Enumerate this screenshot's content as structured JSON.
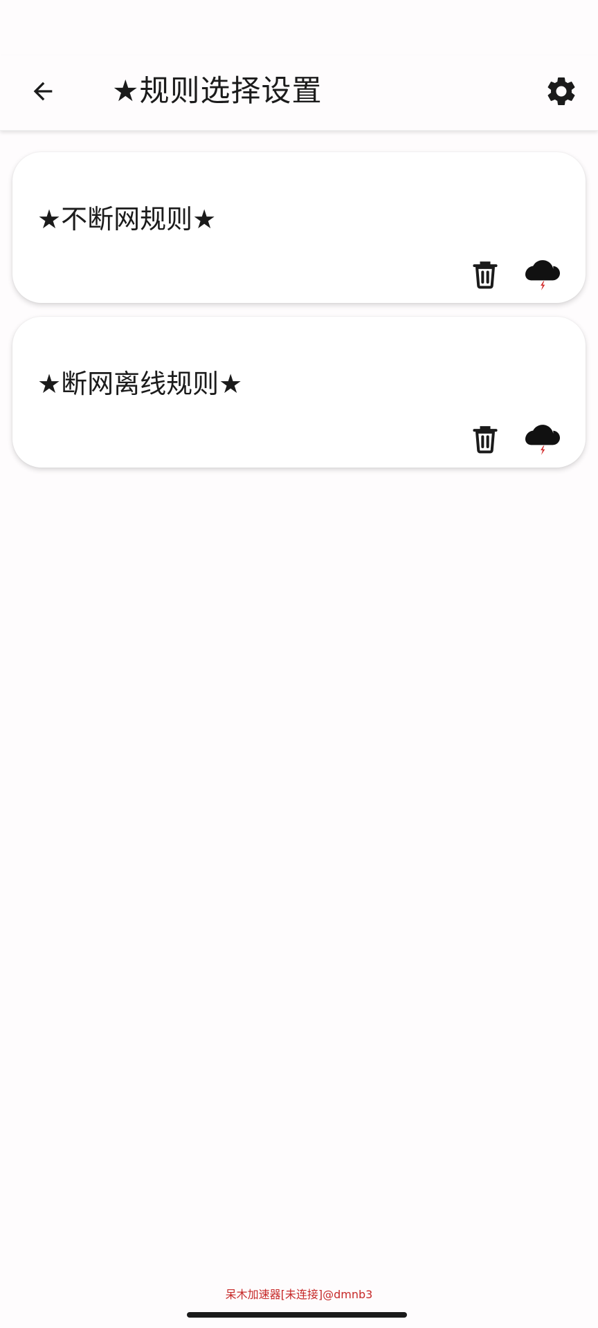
{
  "header": {
    "back_icon": "arrow-left-icon",
    "title": "★规则选择设置",
    "settings_icon": "gear-icon"
  },
  "rules": [
    {
      "name": "★不断网规则★",
      "delete_icon": "trash-icon",
      "cloud_icon": "cloud-upload-icon"
    },
    {
      "name": "★断网离线规则★",
      "delete_icon": "trash-icon",
      "cloud_icon": "cloud-upload-icon"
    }
  ],
  "footer": {
    "status_text": "呆木加速器[未连接]@dmnb3"
  },
  "colors": {
    "background": "#fefcfd",
    "text": "#1b1b1b",
    "footer": "#c62828",
    "cloud_bolt": "#d32f2f"
  }
}
